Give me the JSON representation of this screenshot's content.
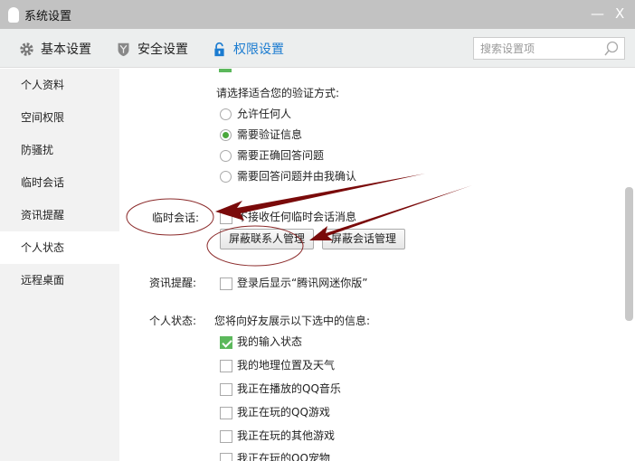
{
  "window": {
    "title": "系统设置",
    "minimize": "—",
    "close": "X"
  },
  "toolbar": {
    "tabs": [
      {
        "label": "基本设置",
        "icon": "gear-icon"
      },
      {
        "label": "安全设置",
        "icon": "shield-icon"
      },
      {
        "label": "权限设置",
        "icon": "lock-icon"
      }
    ],
    "search_placeholder": "搜索设置项"
  },
  "sidebar": {
    "items": [
      "个人资料",
      "空间权限",
      "防骚扰",
      "临时会话",
      "资讯提醒",
      "个人状态",
      "远程桌面"
    ],
    "selected": "个人状态"
  },
  "verify": {
    "prompt": "请选择适合您的验证方式:",
    "options": [
      "允许任何人",
      "需要验证信息",
      "需要正确回答问题",
      "需要回答问题并由我确认"
    ],
    "selected": 1
  },
  "temp_chat": {
    "label": "临时会话:",
    "checkbox": "不接收任何临时会话消息",
    "checked": false,
    "buttons": [
      "屏蔽联系人管理",
      "屏蔽会话管理"
    ]
  },
  "news": {
    "label": "资讯提醒:",
    "checkbox": "登录后显示“腾讯网迷你版”",
    "checked": false
  },
  "status": {
    "label": "个人状态:",
    "prompt": "您将向好友展示以下选中的信息:",
    "items": [
      {
        "label": "我的输入状态",
        "checked": true
      },
      {
        "label": "我的地理位置及天气",
        "checked": false
      },
      {
        "label": "我正在播放的QQ音乐",
        "checked": false
      },
      {
        "label": "我正在玩的QQ游戏",
        "checked": false
      },
      {
        "label": "我正在玩的其他游戏",
        "checked": false
      },
      {
        "label": "我正在玩的QQ宠物",
        "checked": false
      }
    ]
  },
  "colors": {
    "accent": "#1a7bd0",
    "annotation": "#7a0a0a",
    "check": "#5cb85c"
  }
}
